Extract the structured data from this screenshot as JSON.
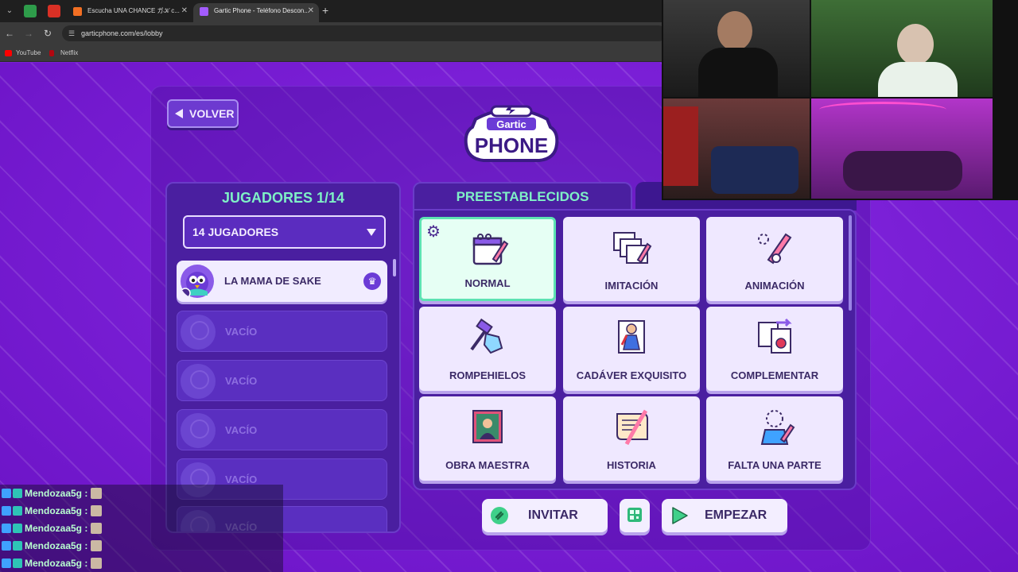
{
  "browser": {
    "tabs": [
      {
        "title": "Escucha UNA CHANCE ガ𝒦 c..."
      },
      {
        "title": "Gartic Phone - Teléfono Descon..."
      }
    ],
    "url": "garticphone.com/es/lobby",
    "bookmarks": [
      "YouTube",
      "Netflix"
    ]
  },
  "lobby": {
    "back_label": "VOLVER",
    "players_title": "JUGADORES 1/14",
    "players_select": "14 JUGADORES",
    "players": [
      {
        "name": "LA MAMA DE SAKE",
        "host": true
      },
      {
        "name": "VACÍO"
      },
      {
        "name": "VACÍO"
      },
      {
        "name": "VACÍO"
      },
      {
        "name": "VACÍO"
      },
      {
        "name": "VACÍO"
      }
    ],
    "presets_title": "PREESTABLECIDOS",
    "presets": [
      {
        "label": "NORMAL",
        "selected": true
      },
      {
        "label": "IMITACIÓN"
      },
      {
        "label": "ANIMACIÓN"
      },
      {
        "label": "ROMPEHIELOS"
      },
      {
        "label": "CADÁVER EXQUISITO"
      },
      {
        "label": "COMPLEMENTAR"
      },
      {
        "label": "OBRA MAESTRA"
      },
      {
        "label": "HISTORIA"
      },
      {
        "label": "FALTA UNA PARTE"
      }
    ],
    "invite_label": "INVITAR",
    "start_label": "EMPEZAR"
  },
  "chat": {
    "lines": [
      {
        "user": "Mendozaa5g",
        "sep": ":"
      },
      {
        "user": "Mendozaa5g",
        "sep": ":"
      },
      {
        "user": "Mendozaa5g",
        "sep": ":"
      },
      {
        "user": "Mendozaa5g",
        "sep": ":"
      },
      {
        "user": "Mendozaa5g",
        "sep": ":"
      }
    ]
  },
  "colors": {
    "accent_green": "#7ff0c6",
    "panel_purple": "#4a1fa0",
    "background_purple": "#7a1fd6",
    "card_light": "#efe8ff"
  }
}
